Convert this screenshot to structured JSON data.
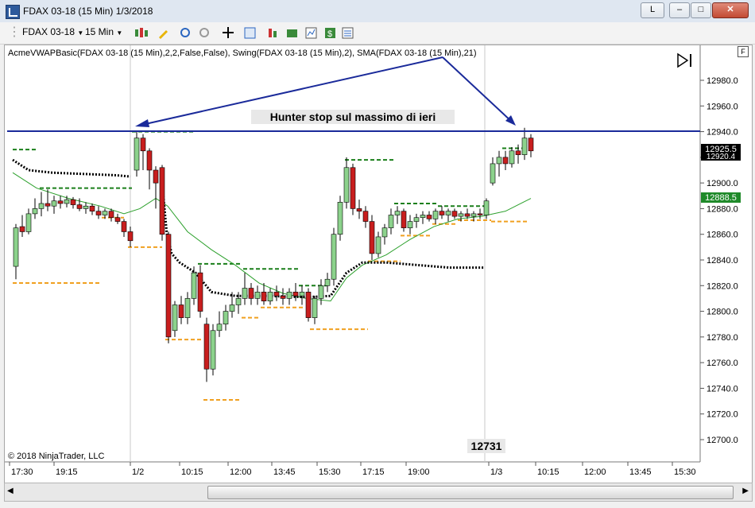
{
  "window": {
    "title": "FDAX 03-18 (15 Min)  1/3/2018",
    "controls": [
      "L",
      "–",
      "□",
      "✕"
    ]
  },
  "toolbar": {
    "instrument": "FDAX 03-18",
    "interval": "15 Min"
  },
  "chart": {
    "indicator_label": "AcmeVWAPBasic(FDAX 03-18 (15 Min),2,2,False,False), Swing(FDAX 03-18 (15 Min),2), SMA(FDAX 03-18 (15 Min),21)",
    "annotation": "Hunter stop sul massimo di ieri",
    "low_label": "12731",
    "copyright": "© 2018 NinjaTrader, LLC",
    "corner_button": "F",
    "price_ticks": [
      "12980.0",
      "12960.0",
      "12940.0",
      "12920.0",
      "12900.0",
      "12880.0",
      "12860.0",
      "12840.0",
      "12820.0",
      "12800.0",
      "12780.0",
      "12760.0",
      "12740.0",
      "12720.0",
      "12700.0"
    ],
    "price_tags": [
      {
        "text": "12925.5",
        "bg": "#000000"
      },
      {
        "text": "12920.4",
        "bg": "#000000"
      },
      {
        "text": "12888.5",
        "bg": "#1f8a2a"
      }
    ],
    "time_ticks": [
      "17:30",
      "19:15",
      "1/2",
      "10:15",
      "12:00",
      "13:45",
      "15:30",
      "17:15",
      "19:00",
      "1/3",
      "10:15",
      "12:00",
      "13:45",
      "15:30"
    ],
    "colors": {
      "up_candle": "#8cd28c",
      "down_candle": "#c81e1e",
      "vwap": "#000000",
      "sma": "#2ca02c",
      "swing_high": "#1a7f1a",
      "swing_low": "#f0a020",
      "hline": "#1a2a9a",
      "arrow": "#1a2a9a"
    }
  }
}
